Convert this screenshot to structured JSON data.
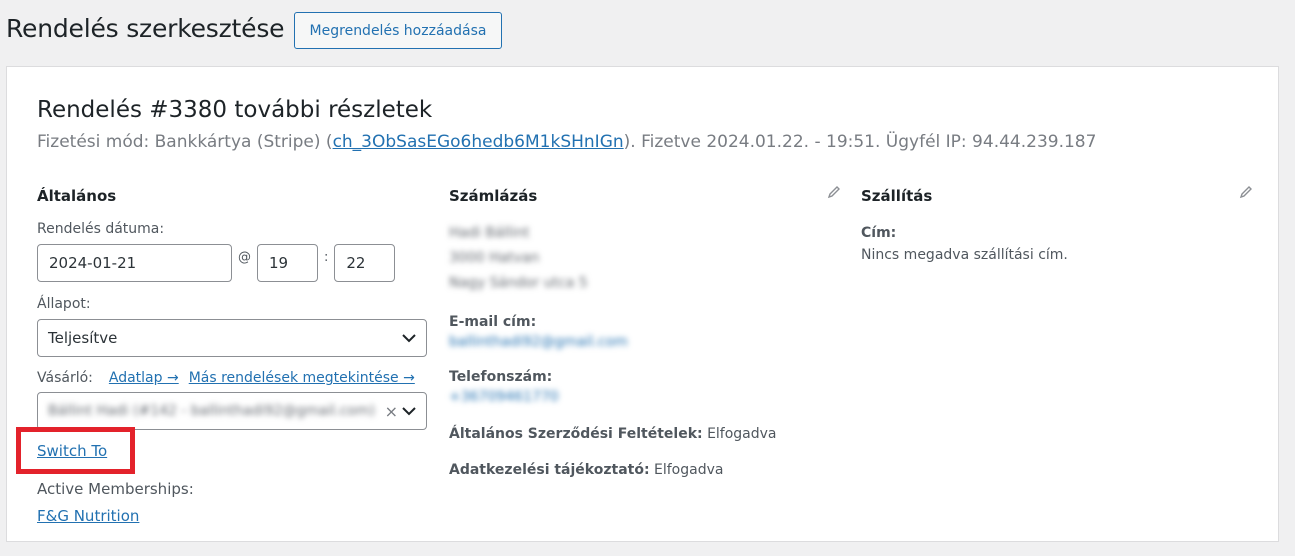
{
  "header": {
    "title": "Rendelés szerkesztése",
    "add_button": "Megrendelés hozzáadása"
  },
  "order": {
    "heading": "Rendelés #3380 további részletek",
    "payment_prefix": "Fizetési mód: Bankkártya (Stripe) (",
    "charge_id": "ch_3ObSasEGo6hedb6M1kSHnIGn",
    "payment_suffix": "). Fizetve 2024.01.22. - 19:51. Ügyfél IP: 94.44.239.187"
  },
  "general": {
    "title": "Általános",
    "date_label": "Rendelés dátuma:",
    "date": "2024-01-21",
    "at": "@",
    "hour": "19",
    "colon": ":",
    "minute": "22",
    "status_label": "Állapot:",
    "status": "Teljesítve",
    "customer_label": "Vásárló:",
    "profile_link": "Adatlap →",
    "other_orders_link": "Más rendelések megtekintése →",
    "customer_value": "Bállint Hadi (#142 - ballinthadi92@gmail.com)",
    "clear": "×",
    "switch_to": "Switch To",
    "memberships_label": "Active Memberships:",
    "membership": "F&G Nutrition"
  },
  "billing": {
    "title": "Számlázás",
    "address_lines": [
      "Hadi Bállint",
      "3000 Hatvan",
      "Nagy Sándor utca 5"
    ],
    "email_label": "E-mail cím:",
    "email": "ballinthadi92@gmail.com",
    "phone_label": "Telefonszám:",
    "phone": "+36709461770",
    "terms_label": "Általános Szerződési Feltételek:",
    "terms_value": "Elfogadva",
    "privacy_label": "Adatkezelési tájékoztató:",
    "privacy_value": "Elfogadva"
  },
  "shipping": {
    "title": "Szállítás",
    "address_label": "Cím:",
    "address_value": "Nincs megadva szállítási cím."
  },
  "icons": {
    "edit": "pencil-icon",
    "chevron": "chevron-down-icon",
    "clear": "close-icon"
  },
  "colors": {
    "accent": "#2271b1",
    "highlight": "#e3222b"
  }
}
